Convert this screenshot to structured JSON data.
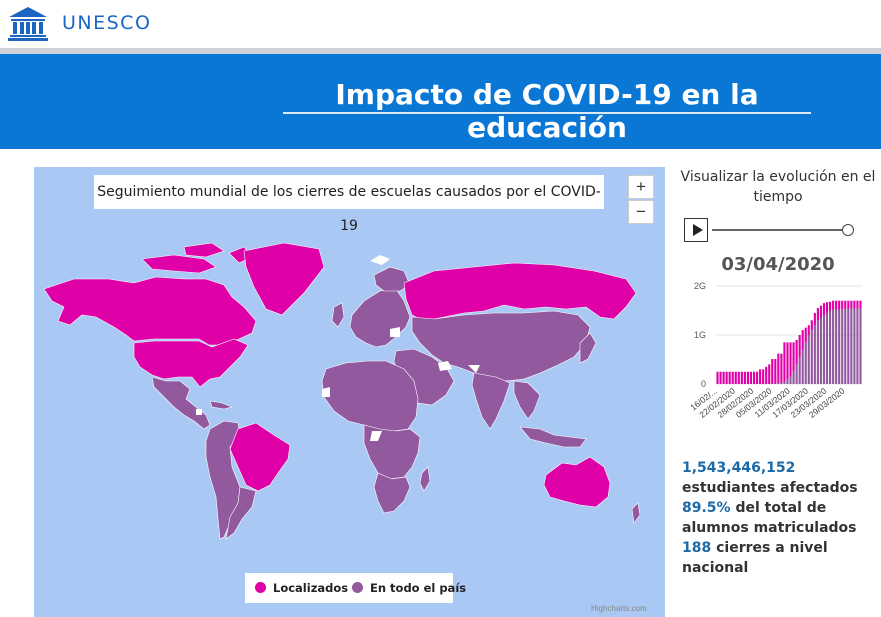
{
  "header": {
    "brand": "UNESCO",
    "banner_title": "Impacto de COVID-19 en la educación",
    "colors": {
      "banner": "#0a77d5",
      "brand_text": "#1a66c2"
    }
  },
  "map": {
    "title": "Seguimiento mundial de los cierres de escuelas causados por el COVID-19",
    "zoom_in": "+",
    "zoom_out": "−",
    "legend": [
      {
        "label": "Localizados",
        "color": "#e000a8"
      },
      {
        "label": "En todo el país",
        "color": "#93599e"
      }
    ],
    "credits": "Highcharts.com",
    "colors": {
      "ocean": "#a9c8f3",
      "no_data": "#ffffff"
    }
  },
  "timeline": {
    "heading": "Visualizar la evolución en el tiempo",
    "current_date": "03/04/2020",
    "slider_position": 1.0,
    "icons": {
      "play": "play-icon"
    }
  },
  "chart_data": {
    "type": "bar",
    "stacked": true,
    "categories": [
      "16/02/...",
      "17/02/2020",
      "18/02/2020",
      "19/02/2020",
      "20/02/2020",
      "21/02/2020",
      "22/02/2020",
      "23/02/2020",
      "24/02/2020",
      "25/02/2020",
      "26/02/2020",
      "27/02/2020",
      "28/02/2020",
      "29/02/2020",
      "01/03/2020",
      "02/03/2020",
      "03/03/2020",
      "04/03/2020",
      "05/03/2020",
      "06/03/2020",
      "07/03/2020",
      "08/03/2020",
      "09/03/2020",
      "10/03/2020",
      "11/03/2020",
      "12/03/2020",
      "13/03/2020",
      "14/03/2020",
      "15/03/2020",
      "16/03/2020",
      "17/03/2020",
      "18/03/2020",
      "19/03/2020",
      "20/03/2020",
      "21/03/2020",
      "22/03/2020",
      "23/03/2020",
      "24/03/2020",
      "25/03/2020",
      "26/03/2020",
      "27/03/2020",
      "28/03/2020",
      "29/03/2020",
      "30/03/2020",
      "31/03/2020",
      "01/04/2020",
      "02/04/2020",
      "03/04/2020"
    ],
    "x_tick_labels": [
      "16/02/...",
      "22/02/2020",
      "28/02/2020",
      "05/03/2020",
      "11/03/2020",
      "17/03/2020",
      "23/03/2020",
      "29/03/2020"
    ],
    "series": [
      {
        "name": "En todo el país",
        "color": "#93599e",
        "values": [
          0,
          0,
          0,
          0,
          0,
          0,
          0,
          0,
          0,
          0,
          0,
          0,
          0,
          0,
          0,
          0,
          0,
          0,
          0.01,
          0.01,
          0.02,
          0.02,
          0.05,
          0.1,
          0.15,
          0.25,
          0.4,
          0.55,
          0.7,
          0.85,
          1.0,
          1.1,
          1.2,
          1.3,
          1.35,
          1.4,
          1.45,
          1.5,
          1.52,
          1.52,
          1.52,
          1.53,
          1.54,
          1.54,
          1.54,
          1.54,
          1.54,
          1.54
        ]
      },
      {
        "name": "Localizados",
        "color": "#e000a8",
        "values": [
          0.25,
          0.25,
          0.25,
          0.25,
          0.25,
          0.25,
          0.25,
          0.25,
          0.25,
          0.25,
          0.25,
          0.25,
          0.25,
          0.25,
          0.3,
          0.3,
          0.35,
          0.4,
          0.5,
          0.5,
          0.6,
          0.6,
          0.8,
          0.75,
          0.7,
          0.6,
          0.5,
          0.45,
          0.4,
          0.3,
          0.2,
          0.2,
          0.25,
          0.25,
          0.25,
          0.25,
          0.22,
          0.18,
          0.18,
          0.18,
          0.18,
          0.17,
          0.16,
          0.16,
          0.16,
          0.16,
          0.16,
          0.16
        ]
      }
    ],
    "yticks": [
      {
        "value": 0,
        "label": "0"
      },
      {
        "value": 1,
        "label": "1G"
      },
      {
        "value": 2,
        "label": "2G"
      }
    ],
    "ylim": [
      0,
      2
    ]
  },
  "stats": {
    "students_value": "1,543,446,152",
    "students_label": "estudiantes afectados",
    "percent_value": "89.5%",
    "percent_label": "del total de alumnos matriculados",
    "closures_value": "188",
    "closures_label": "cierres a nivel nacional"
  }
}
